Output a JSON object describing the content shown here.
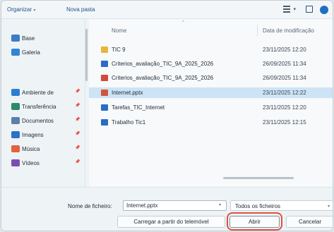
{
  "toolbar": {
    "organize_label": "Organizar",
    "organize_caret": "▾",
    "new_folder_label": "Nova pasta",
    "view_dropdown_caret": "▾"
  },
  "nav": {
    "items": [
      {
        "label": "Base",
        "icon": "home-icon",
        "color": "#3b7cc4",
        "pinned": false
      },
      {
        "label": "Galeria",
        "icon": "gallery-icon",
        "color": "#2f86d6",
        "pinned": false
      },
      {
        "label": "Ambiente de",
        "icon": "desktop-icon",
        "color": "#2c7fd0",
        "pinned": true
      },
      {
        "label": "Transferência",
        "icon": "download-icon",
        "color": "#2c8a6a",
        "pinned": true
      },
      {
        "label": "Documentos",
        "icon": "documents-icon",
        "color": "#5a7fa8",
        "pinned": true
      },
      {
        "label": "Imagens",
        "icon": "pictures-icon",
        "color": "#2a73c6",
        "pinned": true
      },
      {
        "label": "Música",
        "icon": "music-icon",
        "color": "#e0623f",
        "pinned": true
      },
      {
        "label": "Vídeos",
        "icon": "videos-icon",
        "color": "#7a4fb0",
        "pinned": true
      }
    ],
    "pin_glyph": "📌"
  },
  "list": {
    "col_name": "Nome",
    "col_date": "Data de modificação",
    "sort_glyph": "^",
    "files": [
      {
        "name": "TIC 9",
        "date": "23/11/2025 12:20",
        "icon": "folder-icon",
        "color": "#e8b43a",
        "selected": false
      },
      {
        "name": "Criterios_avaliação_TIC_9A_2025_2026",
        "date": "26/09/2025 11:34",
        "icon": "word-doc-icon",
        "color": "#2b6cc4",
        "selected": false
      },
      {
        "name": "Criterios_avaliação_TIC_9A_2025_2026",
        "date": "26/09/2025 11:34",
        "icon": "pdf-icon",
        "color": "#d24a3c",
        "selected": false
      },
      {
        "name": "Internet.pptx",
        "date": "23/11/2025 12:22",
        "icon": "powerpoint-icon",
        "color": "#d2553b",
        "selected": true
      },
      {
        "name": "Tarefas_TIC_Internet",
        "date": "23/11/2025 12:20",
        "icon": "word-doc-icon",
        "color": "#2b6cc4",
        "selected": false
      },
      {
        "name": "Trabalho Tic1",
        "date": "23/11/2025 12:15",
        "icon": "word-doc-icon",
        "color": "#2b6cc4",
        "selected": false
      }
    ]
  },
  "footer": {
    "filename_label": "Nome de ficheiro:",
    "filename_value": "Internet.pptx",
    "filename_caret": "▾",
    "filetype_value": "Todos os ficheiros",
    "filetype_caret": "▾",
    "upload_label": "Carregar a partir do telemóvel",
    "open_label": "Abrir",
    "cancel_label": "Cancelar",
    "highlight_color": "#e0503f"
  }
}
